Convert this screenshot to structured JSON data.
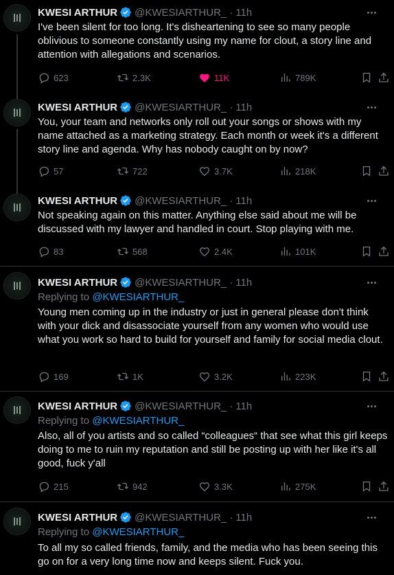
{
  "accent_color": "#1d9bf0",
  "like_color": "#f91880",
  "tweets": [
    {
      "name": "KWESI ARTHUR",
      "handle": "@KWESIARTHUR_",
      "time": "11h",
      "replying_to": null,
      "text": "I've been silent for too long. It's disheartening to see so many people oblivious to someone constantly using my name for clout, a story line and attention with allegations and scenarios.",
      "replies": "623",
      "retweets": "2.3K",
      "likes": "11K",
      "liked": true,
      "views": "789K"
    },
    {
      "name": "KWESI ARTHUR",
      "handle": "@KWESIARTHUR_",
      "time": "11h",
      "replying_to": null,
      "text": "You, your team and networks only roll out your songs or shows with my name attached as a marketing strategy. Each month or week it's a different story line and agenda. Why has nobody caught on by now?",
      "replies": "57",
      "retweets": "722",
      "likes": "3.7K",
      "liked": false,
      "views": "218K"
    },
    {
      "name": "KWESI ARTHUR",
      "handle": "@KWESIARTHUR_",
      "time": "11h",
      "replying_to": null,
      "text": "Not speaking again on this matter. Anything else said about me will be discussed with my lawyer and handled in court. Stop playing with me.",
      "replies": "83",
      "retweets": "568",
      "likes": "2.4K",
      "liked": false,
      "views": "101K"
    },
    {
      "name": "KWESI ARTHUR",
      "handle": "@KWESIARTHUR_",
      "time": "11h",
      "replying_to": "@KWESIARTHUR_",
      "text": "Young men coming up in the industry or just in general please don't think with your dick and  disassociate yourself from any women who would use what you work so hard to build for yourself and family for social media clout.",
      "replies": "169",
      "retweets": "1K",
      "likes": "3.2K",
      "liked": false,
      "views": "223K"
    },
    {
      "name": "KWESI ARTHUR",
      "handle": "@KWESIARTHUR_",
      "time": "11h",
      "replying_to": "@KWESIARTHUR_",
      "text": "Also, all of you artists and so called “colleagues“ that see what this girl keeps doing to me to ruin my reputation and still be posting up with her like it's all good, fuck y'all",
      "replies": "215",
      "retweets": "942",
      "likes": "3.3K",
      "liked": false,
      "views": "275K"
    },
    {
      "name": "KWESI ARTHUR",
      "handle": "@KWESIARTHUR_",
      "time": "11h",
      "replying_to": "@KWESIARTHUR_",
      "text": "To all my so called friends, family, and the media who has been seeing this go on for a very long time now and keeps silent. Fuck you.",
      "replies": null,
      "retweets": null,
      "likes": null,
      "liked": false,
      "views": null
    }
  ],
  "labels": {
    "replying_prefix": "Replying to ",
    "separator": "·"
  },
  "icons": {
    "verified": "verified-badge-icon",
    "more": "more-options-icon",
    "reply": "reply-icon",
    "retweet": "retweet-icon",
    "like": "heart-icon",
    "views": "views-chart-icon",
    "bookmark": "bookmark-icon",
    "share": "share-icon"
  }
}
